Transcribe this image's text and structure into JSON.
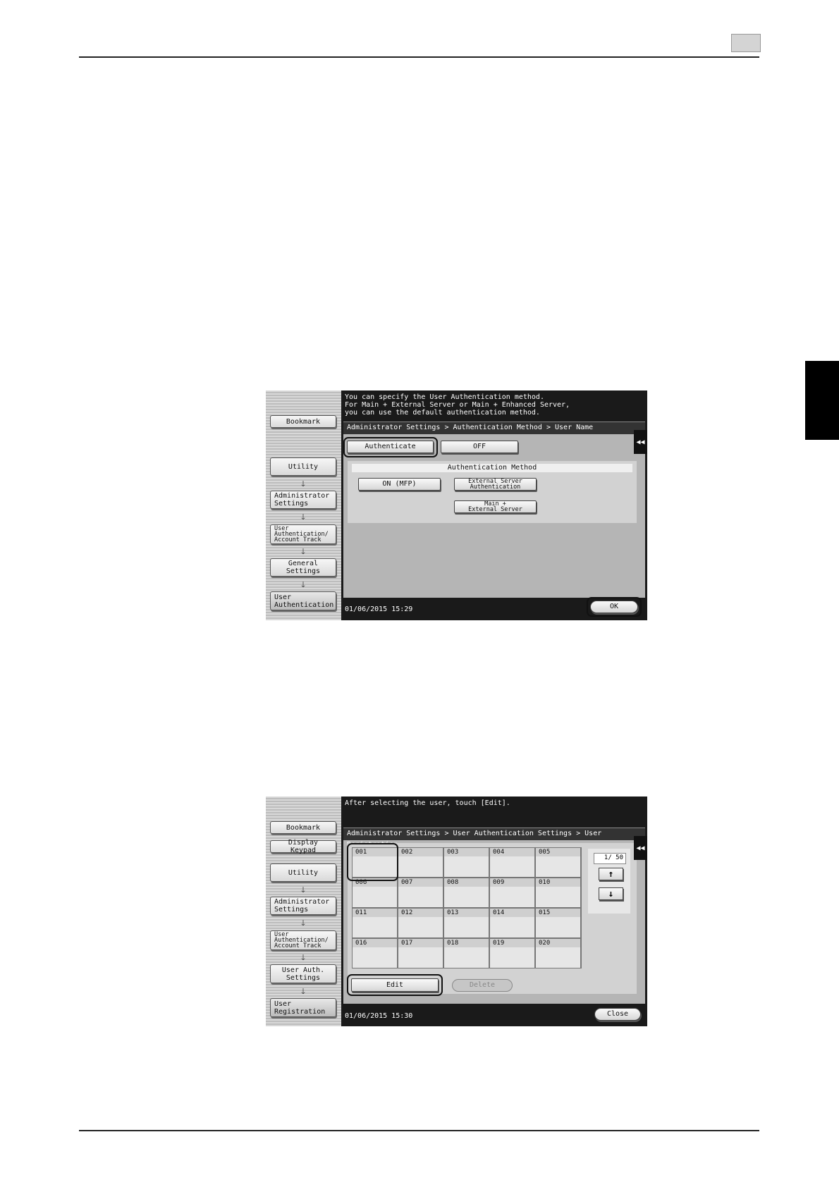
{
  "page": {
    "header_box_label": "",
    "side_tab_label": ""
  },
  "screen1": {
    "sidebar": {
      "bookmark": "Bookmark",
      "nav": [
        "Utility",
        "Administrator\nSettings",
        "User\nAuthentication/\nAccount Track",
        "General Settings",
        "User\nAuthentication"
      ]
    },
    "message": "You can specify the User Authentication method.\nFor Main + External Server or Main + Enhanced Server,\nyou can use the default authentication method.",
    "breadcrumb": "Administrator Settings > Authentication Method > User Name",
    "authenticate_label": "Authenticate",
    "off_label": "OFF",
    "section_title": "Authentication Method",
    "on_mfp_label": "ON (MFP)",
    "external_server_label": "External Server\nAuthentication",
    "main_external_label": "Main +\nExternal Server",
    "datetime": "01/06/2015  15:29",
    "ok_label": "OK",
    "collapse_icon": "double-chevron-left"
  },
  "screen2": {
    "sidebar": {
      "bookmark": "Bookmark",
      "display_keypad": "Display Keypad",
      "nav": [
        "Utility",
        "Administrator\nSettings",
        "User\nAuthentication/\nAccount Track",
        "User Auth.\nSettings",
        "User\nRegistration"
      ]
    },
    "message": "After selecting the user, touch [Edit].",
    "breadcrumb": "Administrator Settings > User Authentication Settings > User Registration",
    "cells": [
      "001",
      "002",
      "003",
      "004",
      "005",
      "006",
      "007",
      "008",
      "009",
      "010",
      "011",
      "012",
      "013",
      "014",
      "015",
      "016",
      "017",
      "018",
      "019",
      "020"
    ],
    "page_indicator": "1/ 50",
    "edit_label": "Edit",
    "delete_label": "Delete",
    "datetime": "01/06/2015  15:30",
    "close_label": "Close",
    "collapse_icon": "double-chevron-left"
  }
}
